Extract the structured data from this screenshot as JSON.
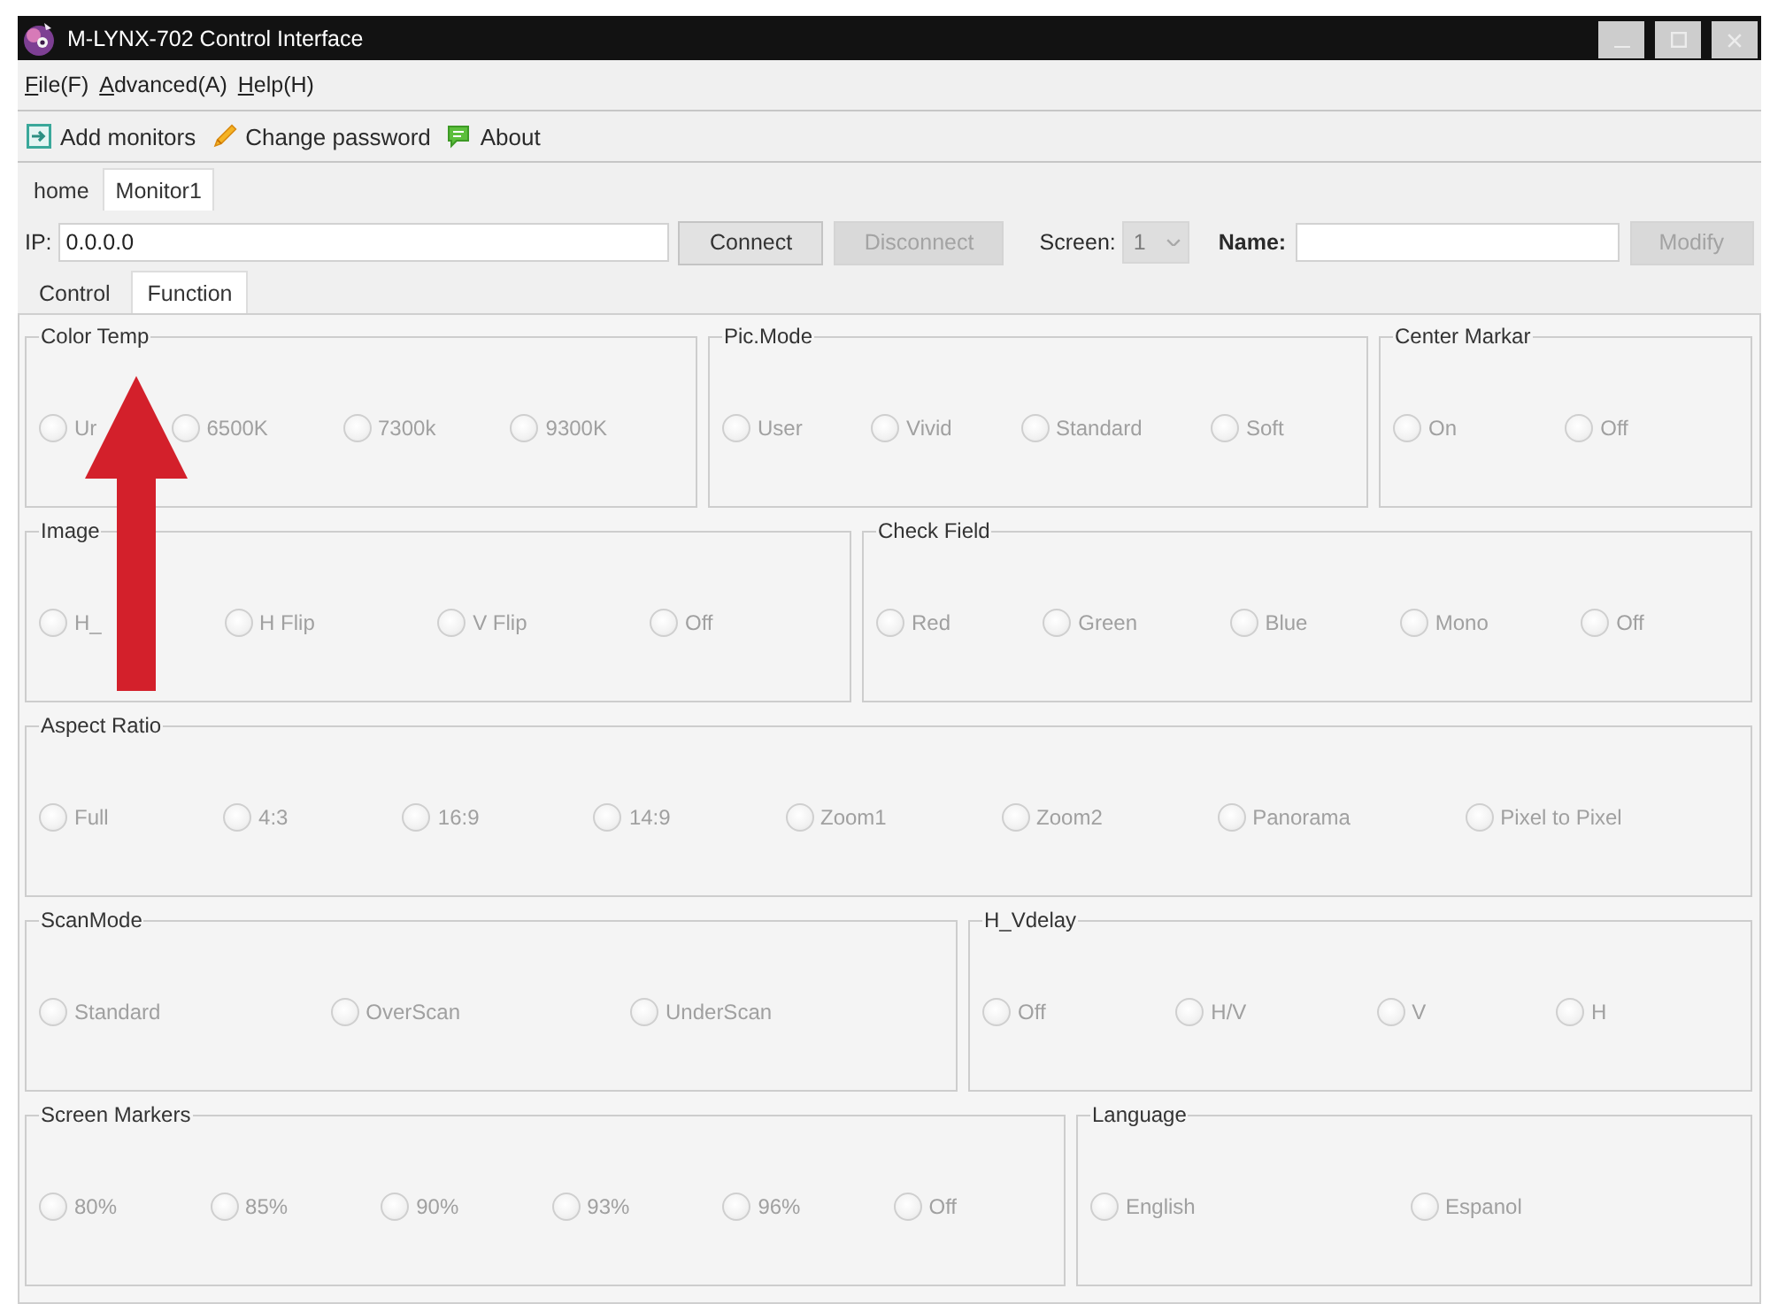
{
  "window": {
    "title": "M-LYNX-702 Control Interface"
  },
  "menu": [
    "File(F)",
    "Advanced(A)",
    "Help(H)"
  ],
  "toolbar": [
    "Add monitors",
    "Change password",
    "About"
  ],
  "document_tabs": [
    {
      "label": "home",
      "selected": false
    },
    {
      "label": "Monitor1",
      "selected": true
    }
  ],
  "connection": {
    "ip_label": "IP:",
    "ip_value": "0.0.0.0",
    "connect": {
      "label": "Connect",
      "disabled": false
    },
    "disconnect": {
      "label": "Disconnect",
      "disabled": true
    },
    "screen_label": "Screen:",
    "screen": {
      "value": "1",
      "disabled": true
    },
    "name_label": "Name:",
    "modify": {
      "label": "Modify",
      "disabled": true
    }
  },
  "panel_tabs": [
    {
      "label": "Control",
      "selected": false
    },
    {
      "label": "Function",
      "selected": true
    }
  ],
  "groups": [
    {
      "title": "Color Temp",
      "options": [
        {
          "label": "Ur",
          "selected": false,
          "disabled": true
        },
        {
          "label": "6500K",
          "selected": false,
          "disabled": true
        },
        {
          "label": "7300k",
          "selected": false,
          "disabled": true
        },
        {
          "label": "9300K",
          "selected": false,
          "disabled": true
        }
      ]
    },
    {
      "title": "Pic.Mode",
      "options": [
        {
          "label": "User",
          "selected": false,
          "disabled": true
        },
        {
          "label": "Vivid",
          "selected": false,
          "disabled": true
        },
        {
          "label": "Standard",
          "selected": false,
          "disabled": true
        },
        {
          "label": "Soft",
          "selected": false,
          "disabled": true
        }
      ]
    },
    {
      "title": "Center Markar",
      "options": [
        {
          "label": "On",
          "selected": false,
          "disabled": true
        },
        {
          "label": "Off",
          "selected": false,
          "disabled": true
        }
      ]
    },
    {
      "title": "Image",
      "options": [
        {
          "label": "H_",
          "selected": false,
          "disabled": true
        },
        {
          "label": "H Flip",
          "selected": false,
          "disabled": true
        },
        {
          "label": "V Flip",
          "selected": false,
          "disabled": true
        },
        {
          "label": "Off",
          "selected": false,
          "disabled": true
        }
      ]
    },
    {
      "title": "Check Field",
      "options": [
        {
          "label": "Red",
          "selected": false,
          "disabled": true
        },
        {
          "label": "Green",
          "selected": false,
          "disabled": true
        },
        {
          "label": "Blue",
          "selected": false,
          "disabled": true
        },
        {
          "label": "Mono",
          "selected": false,
          "disabled": true
        },
        {
          "label": "Off",
          "selected": false,
          "disabled": true
        }
      ]
    },
    {
      "title": "Aspect Ratio",
      "options": [
        {
          "label": "Full",
          "selected": false,
          "disabled": true
        },
        {
          "label": "4:3",
          "selected": false,
          "disabled": true
        },
        {
          "label": "16:9",
          "selected": false,
          "disabled": true
        },
        {
          "label": "14:9",
          "selected": false,
          "disabled": true
        },
        {
          "label": "Zoom1",
          "selected": false,
          "disabled": true
        },
        {
          "label": "Zoom2",
          "selected": false,
          "disabled": true
        },
        {
          "label": "Panorama",
          "selected": false,
          "disabled": true
        },
        {
          "label": "Pixel to Pixel",
          "selected": false,
          "disabled": true
        }
      ]
    },
    {
      "title": "ScanMode",
      "options": [
        {
          "label": "Standard",
          "selected": false,
          "disabled": true
        },
        {
          "label": "OverScan",
          "selected": false,
          "disabled": true
        },
        {
          "label": "UnderScan",
          "selected": false,
          "disabled": true
        }
      ]
    },
    {
      "title": "H_Vdelay",
      "options": [
        {
          "label": "Off",
          "selected": false,
          "disabled": true
        },
        {
          "label": "H/V",
          "selected": false,
          "disabled": true
        },
        {
          "label": "V",
          "selected": false,
          "disabled": true
        },
        {
          "label": "H",
          "selected": false,
          "disabled": true
        }
      ]
    },
    {
      "title": "Screen Markers",
      "options": [
        {
          "label": "80%",
          "selected": false,
          "disabled": true
        },
        {
          "label": "85%",
          "selected": false,
          "disabled": true
        },
        {
          "label": "90%",
          "selected": false,
          "disabled": true
        },
        {
          "label": "93%",
          "selected": false,
          "disabled": true
        },
        {
          "label": "96%",
          "selected": false,
          "disabled": true
        },
        {
          "label": "Off",
          "selected": false,
          "disabled": true
        }
      ]
    },
    {
      "title": "Language",
      "options": [
        {
          "label": "English",
          "selected": false,
          "disabled": true
        },
        {
          "label": "Espanol",
          "selected": false,
          "disabled": true
        }
      ]
    }
  ]
}
